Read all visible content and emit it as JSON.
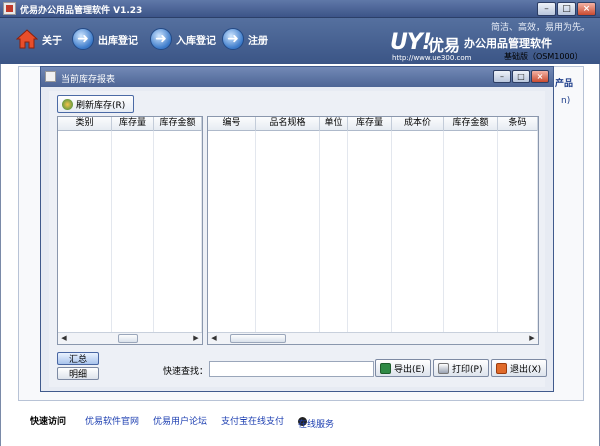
{
  "app": {
    "title": "优易办公用品管理软件 V1.23",
    "window_buttons": {
      "minimize": "–",
      "restore": "□",
      "close": "×"
    }
  },
  "toolbar": {
    "items": [
      {
        "label": "关于",
        "icon": "home-icon"
      },
      {
        "label": "出库登记",
        "icon": "arrow-circle-icon"
      },
      {
        "label": "入库登记",
        "icon": "arrow-circle-icon"
      },
      {
        "label": "注册",
        "icon": "arrow-circle-icon"
      }
    ]
  },
  "brand": {
    "slogan": "简洁、高效，易用为先。",
    "logo_mark": "UY!",
    "logo_cn": "优易",
    "product_name": "办公用品管理软件",
    "url": "http://www.ue300.com",
    "edition": "基础版（OSM1000）"
  },
  "background": {
    "peek1": "产品",
    "peek2": "n)"
  },
  "report_window": {
    "title": "当前库存报表",
    "refresh_button": "刷新库存(R)",
    "left_grid": {
      "columns": [
        "类别",
        "库存量",
        "库存金额"
      ]
    },
    "right_grid": {
      "columns": [
        "编号",
        "品名规格",
        "单位",
        "库存量",
        "成本价",
        "库存金额",
        "条码"
      ]
    },
    "summary_button": "汇总",
    "detail_button": "明细",
    "quick_search_label": "快速查找：",
    "quick_search_value": "",
    "export_button": "导出(E)",
    "print_button": "打印(P)",
    "exit_button": "退出(X)"
  },
  "footer": {
    "quick_access": "快速访问",
    "links": [
      "优易软件官网",
      "优易用户论坛",
      "支付宝在线支付",
      "在线服务"
    ]
  },
  "colors": {
    "title_bar": "#4a6396",
    "header_bg": "#4b6596",
    "link": "#1d3fb1",
    "window_bg": "#e7ebf3"
  }
}
